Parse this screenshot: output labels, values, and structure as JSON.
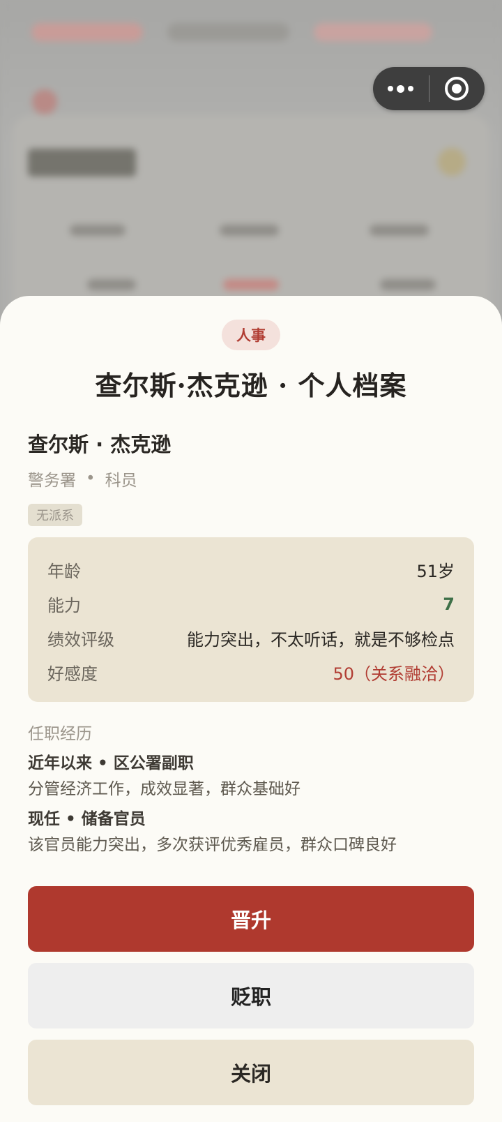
{
  "colors": {
    "primary": "#af392e",
    "accent_green": "#3e7048",
    "accent_red": "#b13d33",
    "sheet_background": "#fcfbf6",
    "card_background": "#ebe4d3"
  },
  "capsule": {
    "more_icon": "more-dots-icon",
    "close_icon": "record-target-icon"
  },
  "sheet": {
    "tag": "人事",
    "title": "查尔斯·杰克逊 · 个人档案",
    "name": "查尔斯 · 杰克逊",
    "department": "警务署",
    "separator": "•",
    "position": "科员",
    "faction": "无派系",
    "info": [
      {
        "label": "年龄",
        "value": "51岁",
        "style": ""
      },
      {
        "label": "能力",
        "value": "7",
        "style": "green"
      },
      {
        "label": "绩效评级",
        "value": "能力突出，不太听话，就是不够检点",
        "style": ""
      },
      {
        "label": "好感度",
        "value": "50（关系融洽）",
        "style": "red"
      }
    ],
    "history_title": "任职经历",
    "history": [
      {
        "heading": "近年以来 • 区公署副职",
        "desc": "分管经济工作，成效显著，群众基础好"
      },
      {
        "heading": "现任 • 储备官员",
        "desc": "该官员能力突出，多次获评优秀雇员，群众口碑良好"
      }
    ],
    "buttons": {
      "promote": "晋升",
      "demote": "贬职",
      "close": "关闭"
    }
  }
}
